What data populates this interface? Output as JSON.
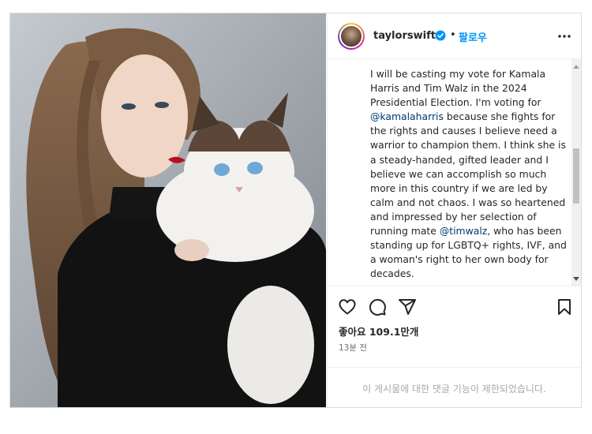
{
  "post": {
    "username": "taylorswift",
    "separator": "•",
    "follow_label": "팔로우",
    "more_icon": "more-dots-icon",
    "caption_parts": {
      "p1": "I will be casting my vote for Kamala Harris and Tim Walz in the 2024 Presidential Election. I'm voting for ",
      "m1": "@kamalaharris",
      "p2": " because she fights for the rights and causes I believe need a warrior to champion them. I think she is a steady-handed, gifted leader and I believe we can accomplish so much more in this country if we are led by calm and not chaos. I was so heartened and impressed by her selection of running mate ",
      "m2": "@timwalz",
      "p3": ", who has been standing up for LGBTQ+ rights, IVF, and a woman's right to her own body for decades."
    },
    "likes_text": "좋아요 109.1만개",
    "time_text": "13분 전",
    "comments_disabled_text": "이 게시물에 대한 댓글 기능이 제한되었습니다."
  },
  "colors": {
    "follow": "#0095f6",
    "verified": "#0095f6",
    "mention": "#00376b",
    "muted": "#737373"
  }
}
